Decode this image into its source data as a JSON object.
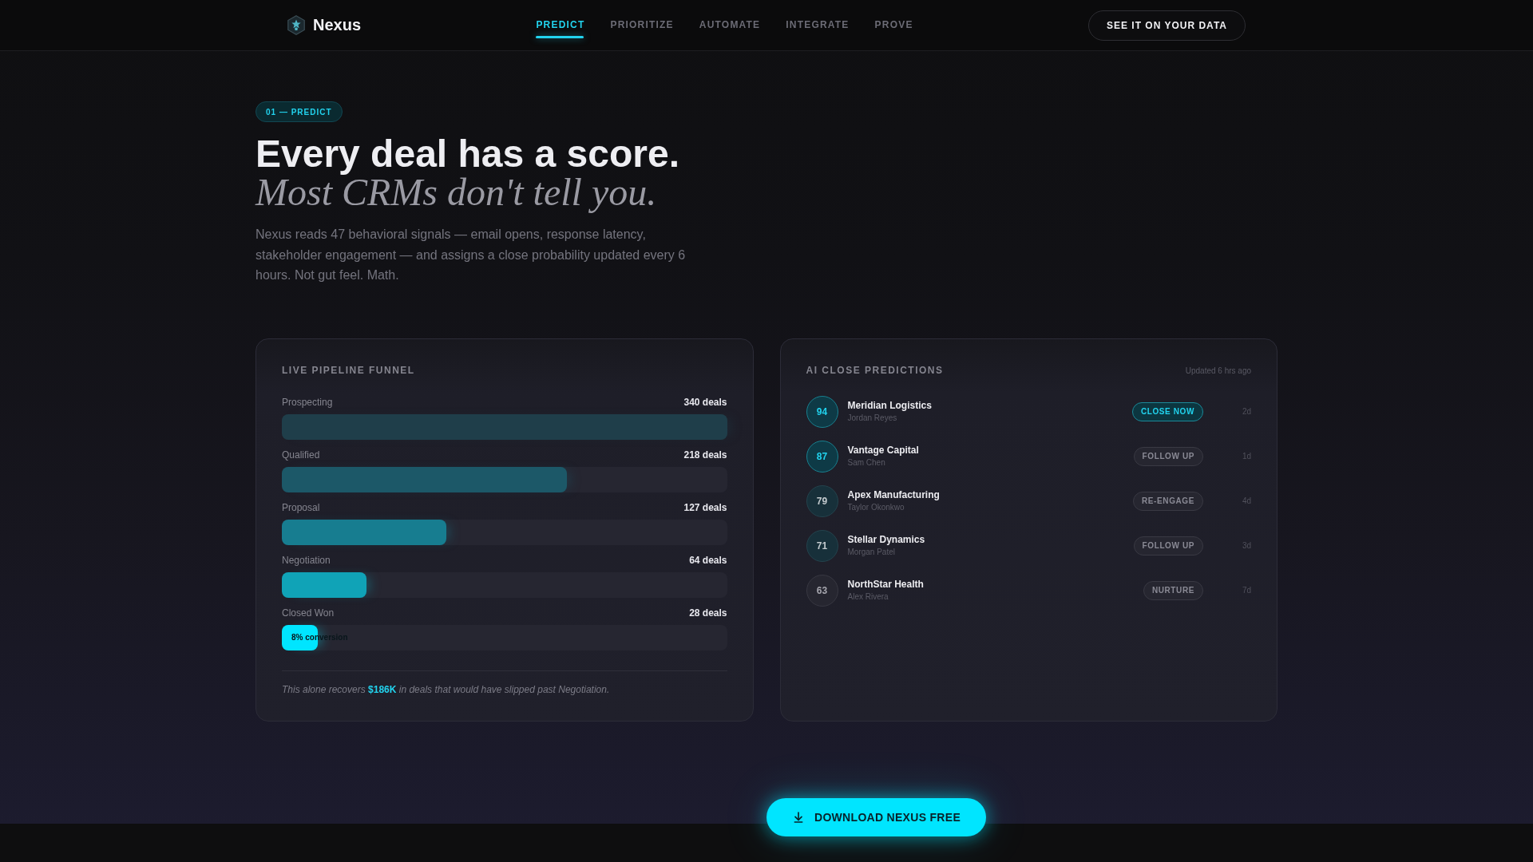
{
  "nav": {
    "brand": "Nexus",
    "links": [
      {
        "label": "PREDICT",
        "selected": true
      },
      {
        "label": "PRIORITIZE",
        "selected": false
      },
      {
        "label": "AUTOMATE",
        "selected": false
      },
      {
        "label": "INTEGRATE",
        "selected": false
      },
      {
        "label": "PROVE",
        "selected": false
      }
    ],
    "cta": "SEE IT ON YOUR DATA"
  },
  "hero": {
    "badge": "01 — PREDICT",
    "headline": "Every deal has a score.",
    "headline_italic": "Most CRMs don't tell you.",
    "body": "Nexus reads 47 behavioral signals — email opens, response latency, stakeholder engagement — and assigns a close probability updated every 6 hours. Not gut feel. Math."
  },
  "funnel": {
    "title": "LIVE PIPELINE FUNNEL",
    "stages": [
      {
        "name": "Prospecting",
        "count": "340 deals",
        "level": 1,
        "color": "#1f3e4a"
      },
      {
        "name": "Qualified",
        "count": "218 deals",
        "level": 0.64,
        "color": "#1c5868"
      },
      {
        "name": "Proposal",
        "count": "127 deals",
        "level": 0.37,
        "color": "#177d90"
      },
      {
        "name": "Negotiation",
        "count": "64 deals",
        "level": 0.19,
        "color": "#10a3b7"
      },
      {
        "name": "Closed Won",
        "count": "28 deals",
        "level": 0.08,
        "color": "#00e5ff",
        "note": "8% conversion"
      }
    ],
    "footnote": "This alone recovers **$186K** in deals that would have slipped past Negotiation."
  },
  "predictions": {
    "title": "AI CLOSE PREDICTIONS",
    "updated": "Updated 6 hrs ago",
    "rows": [
      {
        "score": "94",
        "kind": "high",
        "company": "Meridian Logistics",
        "contact": "Jordan Reyes",
        "action": "CLOSE NOW",
        "urgent": true,
        "age": "2d"
      },
      {
        "score": "87",
        "kind": "high",
        "company": "Vantage Capital",
        "contact": "Sam Chen",
        "action": "FOLLOW UP",
        "urgent": false,
        "age": "1d"
      },
      {
        "score": "79",
        "kind": "mid",
        "company": "Apex Manufacturing",
        "contact": "Taylor Okonkwo",
        "action": "RE-ENGAGE",
        "urgent": false,
        "age": "4d"
      },
      {
        "score": "71",
        "kind": "mid",
        "company": "Stellar Dynamics",
        "contact": "Morgan Patel",
        "action": "FOLLOW UP",
        "urgent": false,
        "age": "3d"
      },
      {
        "score": "63",
        "kind": "low",
        "company": "NorthStar Health",
        "contact": "Alex Rivera",
        "action": "NURTURE",
        "urgent": false,
        "age": "7d"
      }
    ]
  },
  "download_button": "DOWNLOAD NEXUS FREE"
}
